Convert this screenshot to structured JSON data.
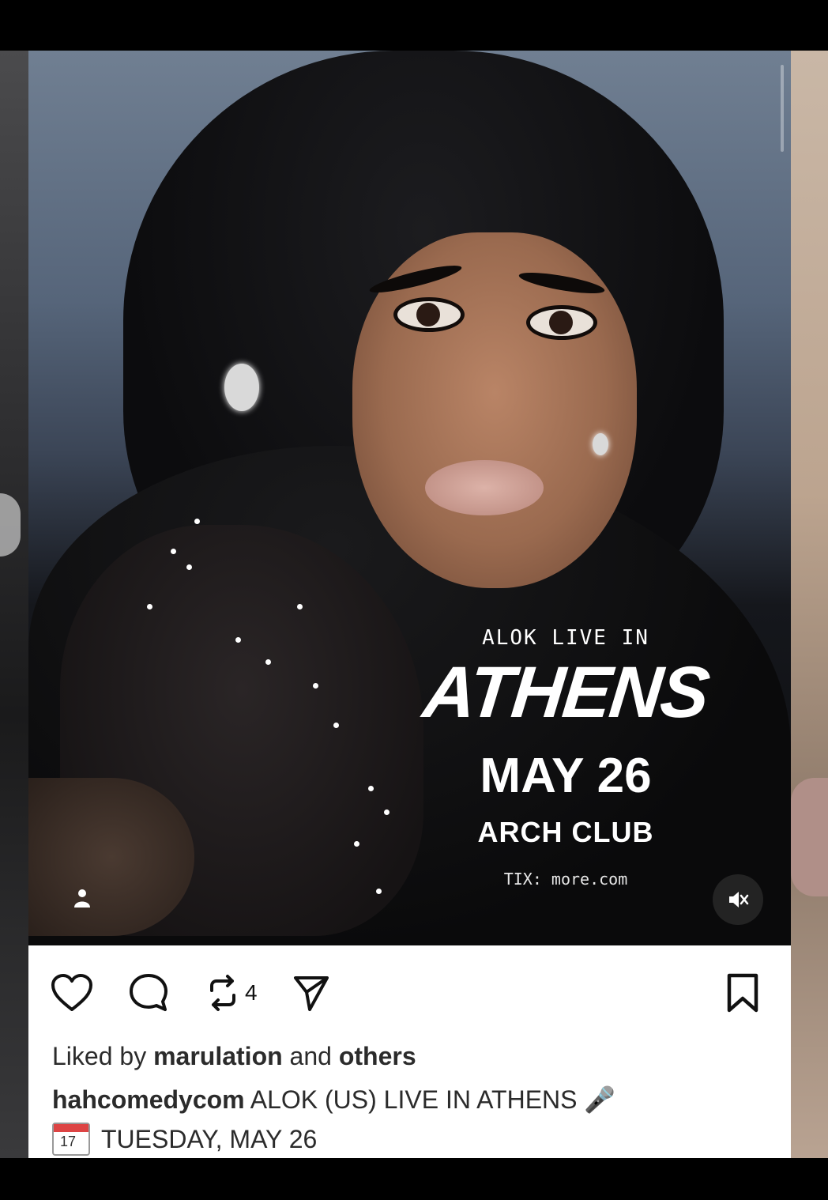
{
  "poster": {
    "pre_title": "ALOK LIVE IN",
    "city": "ATHENS",
    "date": "MAY 26",
    "venue": "ARCH CLUB",
    "tickets": "TIX: more.com"
  },
  "controls": {
    "tag_icon": "person-icon",
    "mute_icon": "speaker-muted-icon"
  },
  "actions": {
    "like_icon": "heart-icon",
    "comment_icon": "comment-icon",
    "repost_icon": "repost-icon",
    "repost_count": "4",
    "share_icon": "send-icon",
    "save_icon": "bookmark-icon"
  },
  "likes": {
    "prefix": "Liked by ",
    "user": "marulation",
    "middle": " and ",
    "others": "others"
  },
  "caption": {
    "username": "hahcomedycom",
    "text": " ALOK (US) LIVE IN ATHENS 🎤",
    "calendar_day": "17",
    "line2": "TUESDAY, MAY 26"
  }
}
